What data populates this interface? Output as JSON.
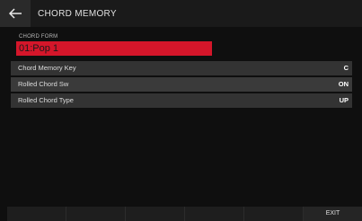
{
  "header": {
    "back_icon": "arrow-left-icon",
    "title": "CHORD MEMORY"
  },
  "chord_form": {
    "label": "CHORD FORM",
    "value": "01:Pop 1",
    "accent_color": "#d4162a"
  },
  "params": [
    {
      "label": "Chord Memory Key",
      "value": "C"
    },
    {
      "label": "Rolled Chord Sw",
      "value": "ON"
    },
    {
      "label": "Rolled Chord Type",
      "value": "UP"
    }
  ],
  "footer": {
    "buttons": [
      "",
      "",
      "",
      "",
      "",
      "EXIT"
    ]
  }
}
